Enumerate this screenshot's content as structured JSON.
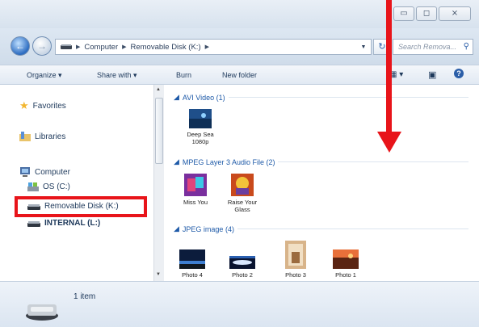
{
  "window": {
    "controls": {
      "minimize": "▭",
      "maximize": "◻",
      "close": "⨯"
    }
  },
  "address": {
    "crumbs": [
      "Computer",
      "Removable Disk (K:)"
    ],
    "search_placeholder": "Search Remova..."
  },
  "toolbar": {
    "organize": "Organize ▾",
    "share": "Share with ▾",
    "burn": "Burn",
    "new_folder": "New folder"
  },
  "nav": {
    "favorites": "Favorites",
    "libraries": "Libraries",
    "computer": "Computer",
    "os": "OS (C:)",
    "removable": "Removable Disk (K:)",
    "internal": "INTERNAL (L:)"
  },
  "groups": {
    "avi": "AVI Video (1)",
    "mp3": "MPEG Layer 3 Audio File (2)",
    "jpeg": "JPEG image (4)"
  },
  "files": {
    "deepsea_line1": "Deep Sea",
    "deepsea_line2": "1080p",
    "missyou": "Miss You",
    "raise_line1": "Raise Your",
    "raise_line2": "Glass",
    "photo4": "Photo 4",
    "photo2": "Photo 2",
    "photo3": "Photo 3",
    "photo1": "Photo 1"
  },
  "status": {
    "count": "1 item"
  },
  "colors": {
    "highlight": "#e8141a",
    "group_header": "#1e5aa8"
  }
}
